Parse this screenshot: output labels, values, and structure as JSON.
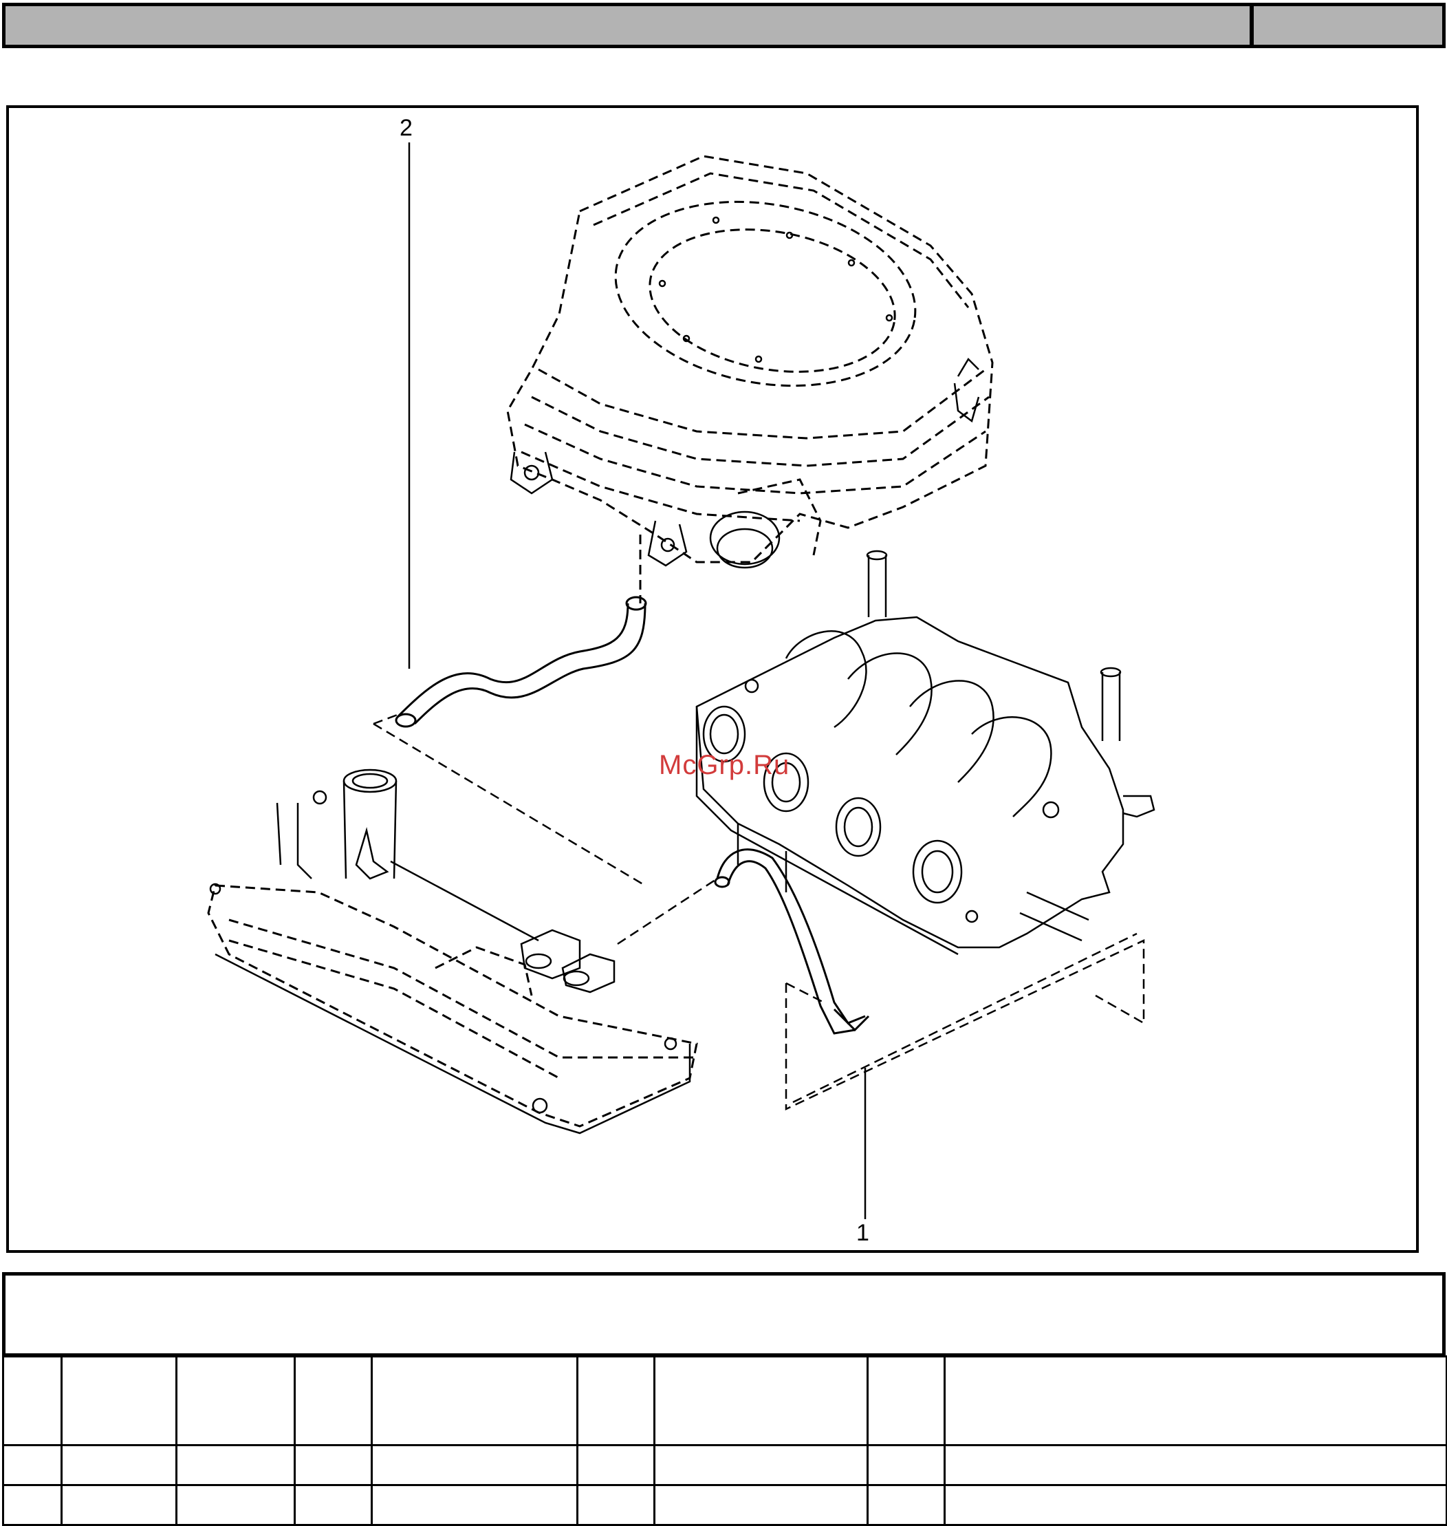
{
  "diagram": {
    "callouts": [
      {
        "id": "2",
        "label": "2"
      },
      {
        "id": "1",
        "label": "1"
      }
    ]
  },
  "watermark": "McGrp.Ru",
  "parts_table": {
    "columns": 9,
    "rows": 3
  }
}
